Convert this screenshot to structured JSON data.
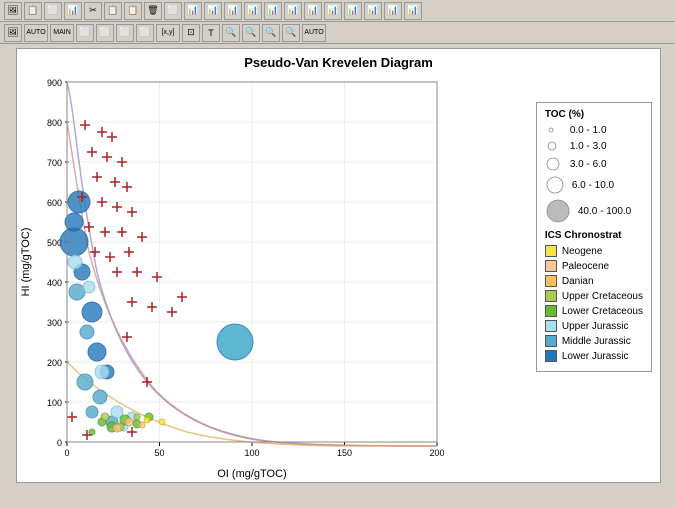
{
  "title": "Pseudo-Van Krevelen Diagram",
  "axes": {
    "x_label": "OI (mg/gTOC)",
    "y_label": "HI (mg/gTOC)",
    "x_min": 0,
    "x_max": 200,
    "y_min": 0,
    "y_max": 900,
    "x_ticks": [
      0,
      50,
      100,
      150,
      200
    ],
    "y_ticks": [
      0,
      100,
      200,
      300,
      400,
      500,
      600,
      700,
      800,
      900
    ]
  },
  "legend_toc": {
    "title": "TOC (%)",
    "items": [
      {
        "label": "0.0 - 1.0",
        "size": 4
      },
      {
        "label": "1.0 - 3.0",
        "size": 7
      },
      {
        "label": "3.0 - 6.0",
        "size": 10
      },
      {
        "label": "6.0 - 10.0",
        "size": 13
      },
      {
        "label": "40.0 - 100.0",
        "size": 18
      }
    ]
  },
  "legend_chron": {
    "title": "ICS Chronostrat",
    "items": [
      {
        "label": "Neogene",
        "color": "#f5e642"
      },
      {
        "label": "Paleocene",
        "color": "#f0b080"
      },
      {
        "label": "Danian",
        "color": "#f0c060"
      },
      {
        "label": "Upper Cretaceous",
        "color": "#99cc66"
      },
      {
        "label": "Lower Cretaceous",
        "color": "#66bb44"
      },
      {
        "label": "Upper Jurassic",
        "color": "#99ddee"
      },
      {
        "label": "Middle Jurassic",
        "color": "#55aacc"
      },
      {
        "label": "Lower Jurassic",
        "color": "#2288bb"
      }
    ]
  },
  "toolbar1": {
    "buttons": [
      "img",
      "img",
      "img",
      "img",
      "img",
      "img",
      "img",
      "img",
      "img",
      "img",
      "img",
      "img",
      "img",
      "img",
      "img",
      "img",
      "img",
      "img",
      "img"
    ]
  },
  "toolbar2": {
    "buttons": [
      "img",
      "AUTO",
      "MAIN",
      "img",
      "img",
      "img",
      "img",
      "[x,y]",
      "img",
      "T",
      "img",
      "img",
      "img",
      "img",
      "img",
      "AUTO"
    ]
  }
}
